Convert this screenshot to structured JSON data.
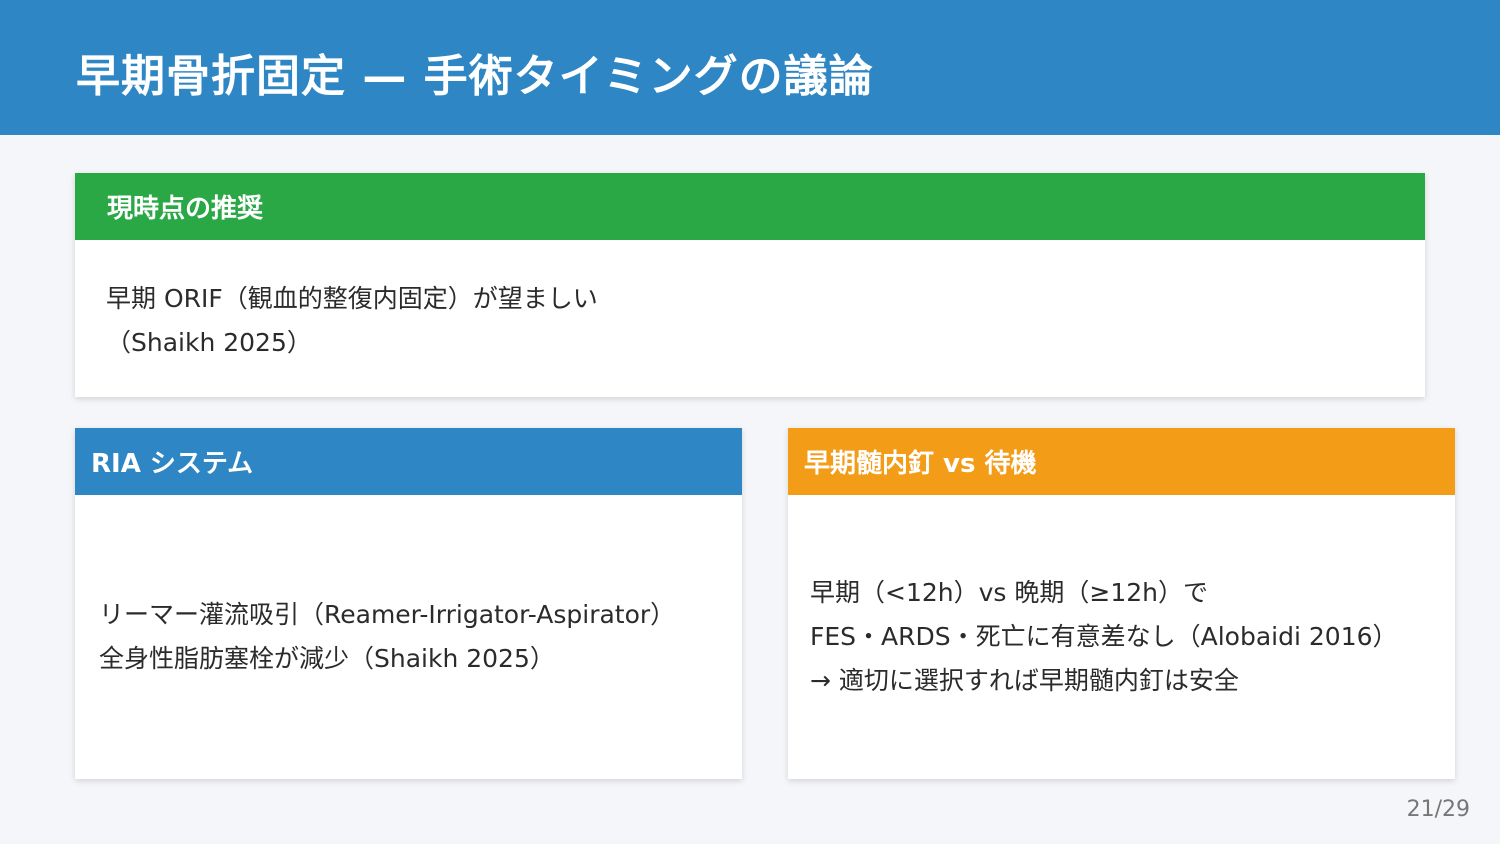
{
  "slide": {
    "title": "早期骨折固定 — 手術タイミングの議論",
    "page_number": "21/29"
  },
  "recommendation": {
    "heading": "現時点の推奨",
    "lines": [
      "早期 ORIF（観血的整復内固定）が望ましい",
      "（Shaikh 2025）"
    ]
  },
  "ria": {
    "heading": "RIA システム",
    "lines": [
      "リーマー灌流吸引（Reamer-Irrigator-Aspirator）",
      "全身性脂肪塞栓が減少（Shaikh 2025）"
    ]
  },
  "early_nailing": {
    "heading": "早期髄内釘 vs 待機",
    "lines": [
      "早期（<12h）vs 晩期（≥12h）で",
      "FES・ARDS・死亡に有意差なし（Alobaidi 2016）",
      "→ 適切に選択すれば早期髄内釘は安全"
    ]
  },
  "colors": {
    "title_bar": "#2e86c4",
    "recommendation_header": "#2aa846",
    "ria_header": "#2e86c4",
    "early_nailing_header": "#f39c18",
    "background": "#f4f6f9"
  }
}
